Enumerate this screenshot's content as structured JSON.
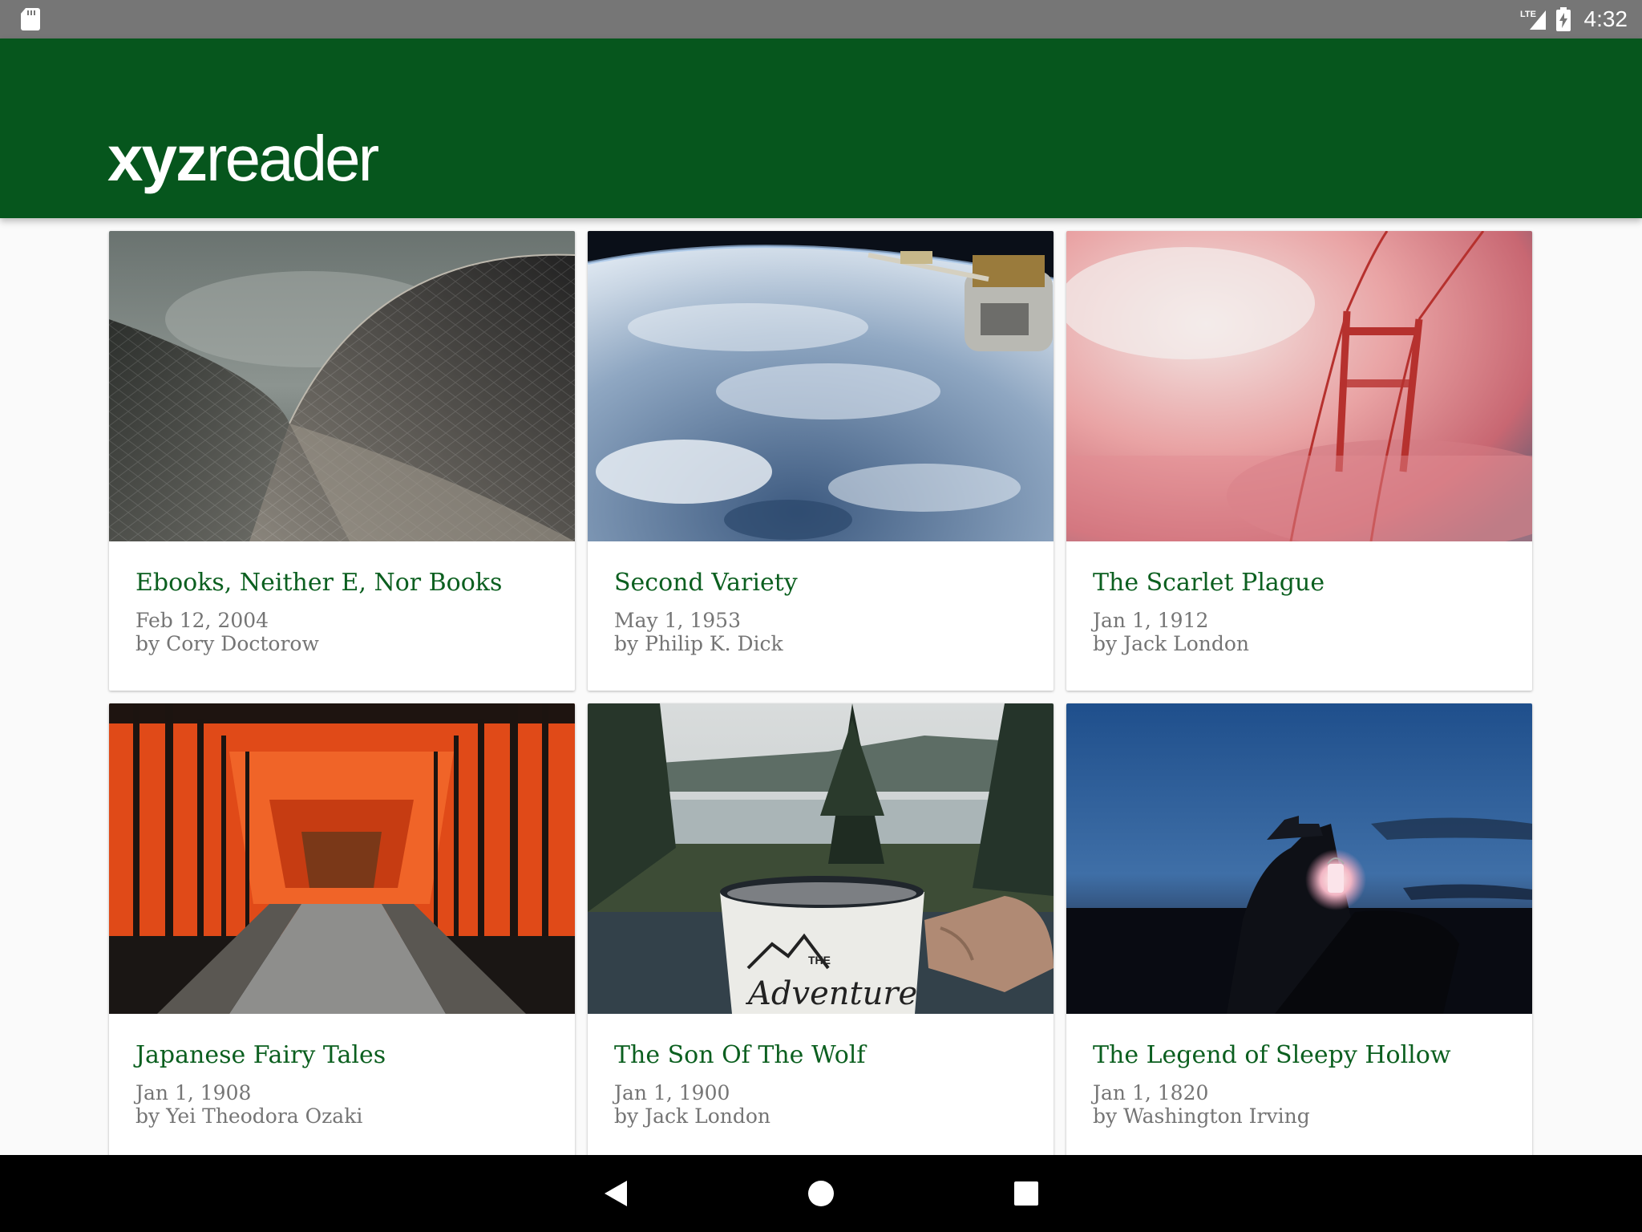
{
  "status_bar": {
    "network": "LTE",
    "time": "4:32",
    "icons": [
      "sd-card-icon",
      "signal-icon",
      "battery-charging-icon"
    ]
  },
  "app_bar": {
    "logo_bold": "xyz",
    "logo_light": "reader",
    "background_color": "#06561d"
  },
  "articles": [
    {
      "title": "Ebooks, Neither E, Nor Books",
      "date": "Feb 12, 2004",
      "byline": "by Cory Doctorow",
      "image": "curved-roof-architecture"
    },
    {
      "title": "Second Variety",
      "date": "May 1, 1953",
      "byline": "by Philip K. Dick",
      "image": "earth-from-space-station"
    },
    {
      "title": "The Scarlet Plague",
      "date": "Jan 1, 1912",
      "byline": "by Jack London",
      "image": "red-bridge-in-fog"
    },
    {
      "title": "Japanese Fairy Tales",
      "date": "Jan 1, 1908",
      "byline": "by Yei Theodora Ozaki",
      "image": "torii-gate-path"
    },
    {
      "title": "The Son Of The Wolf",
      "date": "Jan 1, 1900",
      "byline": "by Jack London",
      "image": "adventure-mug-lake"
    },
    {
      "title": "The Legend of Sleepy Hollow",
      "date": "Jan 1, 1820",
      "byline": "by Washington Irving",
      "image": "rider-with-lantern-dusk"
    }
  ],
  "nav_bar": {
    "buttons": [
      "back",
      "home",
      "recents"
    ]
  },
  "theme": {
    "title_color": "#0b5f1f",
    "meta_color": "#757575",
    "status_bar_color": "#767676"
  }
}
